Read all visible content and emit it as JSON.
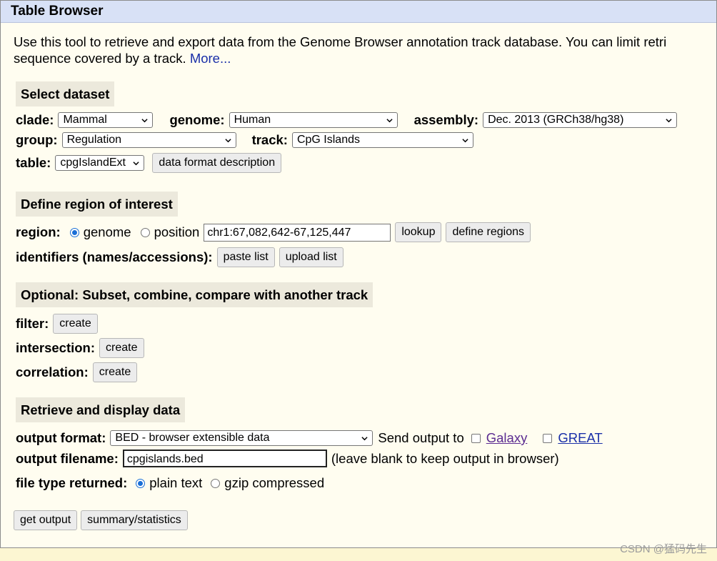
{
  "title": "Table Browser",
  "intro": {
    "line1": "Use this tool to retrieve and export data from the Genome Browser annotation track database. You can limit retri",
    "line2": "sequence covered by a track. ",
    "more_link": "More..."
  },
  "select_dataset": {
    "heading": "Select dataset",
    "clade_label": "clade:",
    "clade_value": "Mammal",
    "genome_label": "genome:",
    "genome_value": "Human",
    "assembly_label": "assembly:",
    "assembly_value": "Dec. 2013 (GRCh38/hg38)",
    "group_label": "group:",
    "group_value": "Regulation",
    "track_label": "track:",
    "track_value": "CpG Islands",
    "table_label": "table:",
    "table_value": "cpgIslandExt",
    "data_format_button": "data format description"
  },
  "define_region": {
    "heading": "Define region of interest",
    "region_label": "region:",
    "genome_option": "genome",
    "position_option": "position",
    "position_value": "chr1:67,082,642-67,125,447",
    "lookup_button": "lookup",
    "define_regions_button": "define regions",
    "identifiers_label": "identifiers (names/accessions):",
    "paste_list_button": "paste list",
    "upload_list_button": "upload list"
  },
  "optional": {
    "heading": "Optional: Subset, combine, compare with another track",
    "filter_label": "filter:",
    "intersection_label": "intersection:",
    "correlation_label": "correlation:",
    "create_button": "create"
  },
  "retrieve": {
    "heading": "Retrieve and display data",
    "output_format_label": "output format:",
    "output_format_value": "BED - browser extensible data",
    "send_output_text": "Send output to",
    "galaxy_link": "Galaxy",
    "great_link": "GREAT",
    "output_filename_label": "output filename:",
    "output_filename_value": "cpgislands.bed",
    "filename_hint": "(leave blank to keep output in browser)",
    "file_type_label": "file type returned:",
    "plain_text_option": "plain text",
    "gzip_option": "gzip compressed"
  },
  "actions": {
    "get_output_button": "get output",
    "summary_button": "summary/statistics"
  },
  "watermark": "CSDN @猛码先生",
  "colors": {
    "title_bar": "#d8e1f6",
    "background": "#fffdf0",
    "section_heading": "#ece9dc",
    "radio_selected": "#1a6fd6",
    "link": "#1a2fa8",
    "visited_link": "#5c2c91"
  }
}
